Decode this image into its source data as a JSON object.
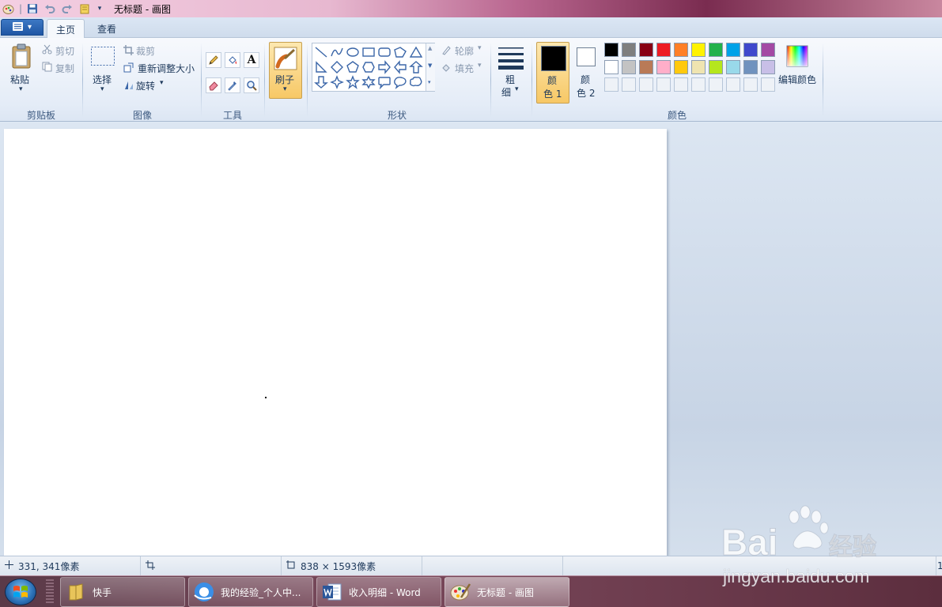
{
  "window": {
    "title": "无标题 - 画图",
    "quick_access": [
      "paint-app-icon",
      "save-icon",
      "undo-icon",
      "redo-icon",
      "customize-qat-icon"
    ]
  },
  "tabs": {
    "active": "主页",
    "view": "查看"
  },
  "ribbon": {
    "clipboard": {
      "paste": "粘贴",
      "cut": "剪切",
      "copy": "复制",
      "group": "剪贴板"
    },
    "image": {
      "select": "选择",
      "crop": "裁剪",
      "resize": "重新调整大小",
      "rotate": "旋转",
      "group": "图像"
    },
    "tools": {
      "group": "工具",
      "items": [
        "pencil-icon",
        "fill-bucket-icon",
        "text-icon",
        "eraser-icon",
        "color-picker-icon",
        "magnifier-icon"
      ]
    },
    "brushes": {
      "label": "刷子"
    },
    "shapes": {
      "group": "形状",
      "outline": "轮廓",
      "fill": "填充"
    },
    "size": {
      "label_1": "粗",
      "label_2": "细"
    },
    "colors": {
      "group": "颜色",
      "color1_a": "颜",
      "color1_b": "色 1",
      "color2_a": "颜",
      "color2_b": "色 2",
      "edit": "编辑颜色",
      "color1_value": "#000000",
      "color2_value": "#ffffff",
      "palette_row1": [
        "#000000",
        "#7f7f7f",
        "#880015",
        "#ed1c24",
        "#ff7f27",
        "#fff200",
        "#22b14c",
        "#00a2e8",
        "#3f48cc",
        "#a349a4"
      ],
      "palette_row2": [
        "#ffffff",
        "#c3c3c3",
        "#b97a57",
        "#ffaec9",
        "#ffc90e",
        "#efe4b0",
        "#b5e61d",
        "#99d9ea",
        "#7092be",
        "#c8bfe7"
      ]
    }
  },
  "status": {
    "cursor": "331, 341像素",
    "selection": "",
    "canvas_size": "838 × 1593像素",
    "zoom_partial": "1"
  },
  "taskbar": {
    "items": [
      {
        "label": "快手",
        "icon": "folder-icon"
      },
      {
        "label": "我的经验_个人中...",
        "icon": "browser-icon"
      },
      {
        "label": "收入明细 - Word",
        "icon": "word-icon"
      },
      {
        "label": "无标题 - 画图",
        "icon": "paint-icon"
      }
    ]
  },
  "watermark": {
    "brand": "Baidu经验",
    "url": "jingyan.baidu.com"
  }
}
